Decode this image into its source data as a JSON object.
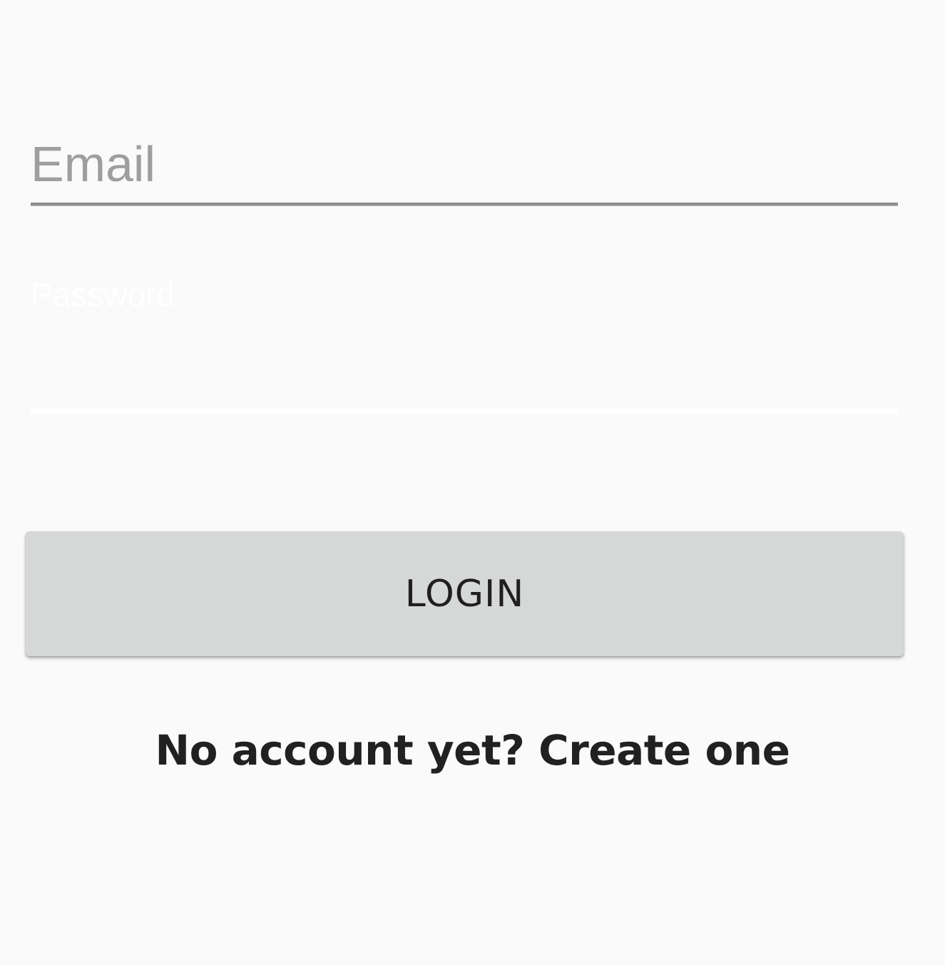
{
  "login_form": {
    "email": {
      "placeholder": "Email",
      "value": ""
    },
    "password": {
      "label": "Password",
      "value": ""
    },
    "login_button_label": "LOGIN",
    "signup_link_text": "No account yet? Create one"
  },
  "colors": {
    "background": "#fafafa",
    "button_background": "#d6d7d7",
    "text_primary": "#212121",
    "placeholder": "#9e9e9e",
    "underline": "#8e8e8e",
    "password_label": "#ffffff"
  }
}
